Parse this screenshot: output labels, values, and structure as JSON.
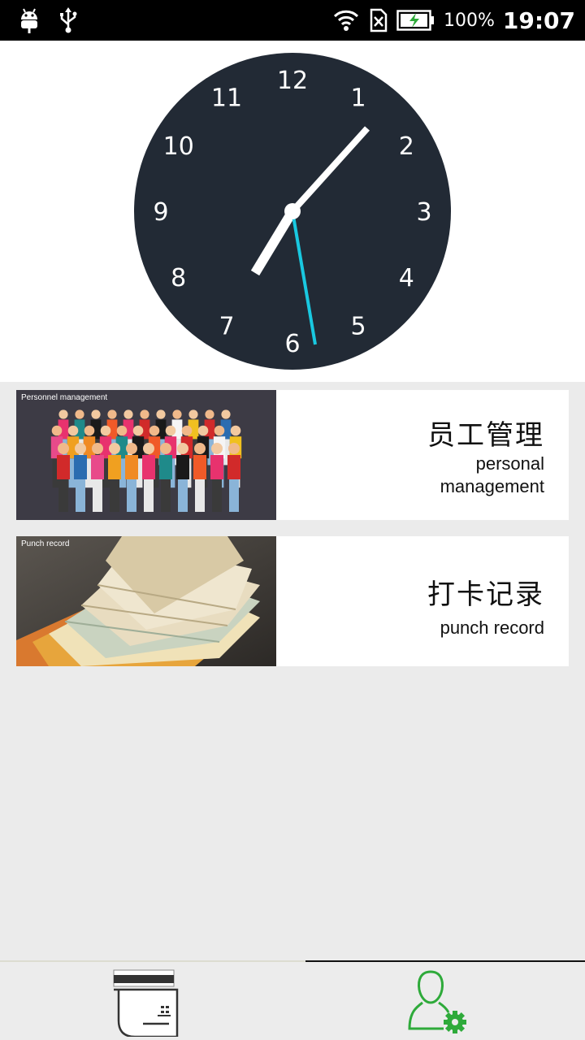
{
  "status_bar": {
    "icons": [
      "android-icon",
      "usb-icon",
      "wifi-icon",
      "no-sim-icon",
      "battery-charging-icon"
    ],
    "battery_percent": "100%",
    "time": "19:07"
  },
  "clock": {
    "numerals": [
      "12",
      "1",
      "2",
      "3",
      "4",
      "5",
      "6",
      "7",
      "8",
      "9",
      "10",
      "11"
    ],
    "face_color": "#222a35",
    "second_hand_color": "#19c8e0",
    "time_shown": "7:07:32"
  },
  "cards": [
    {
      "caption": "Personnel management",
      "title": "员工管理",
      "subtitle_line1": "personal",
      "subtitle_line2": "management"
    },
    {
      "caption": "Punch record",
      "title": "打卡记录",
      "subtitle_line1": "punch record"
    }
  ],
  "bottom_nav": {
    "tabs": [
      {
        "icon": "time-card-icon",
        "selected": false
      },
      {
        "icon": "user-settings-icon",
        "selected": true
      }
    ],
    "accent": "#2eaa3a"
  }
}
